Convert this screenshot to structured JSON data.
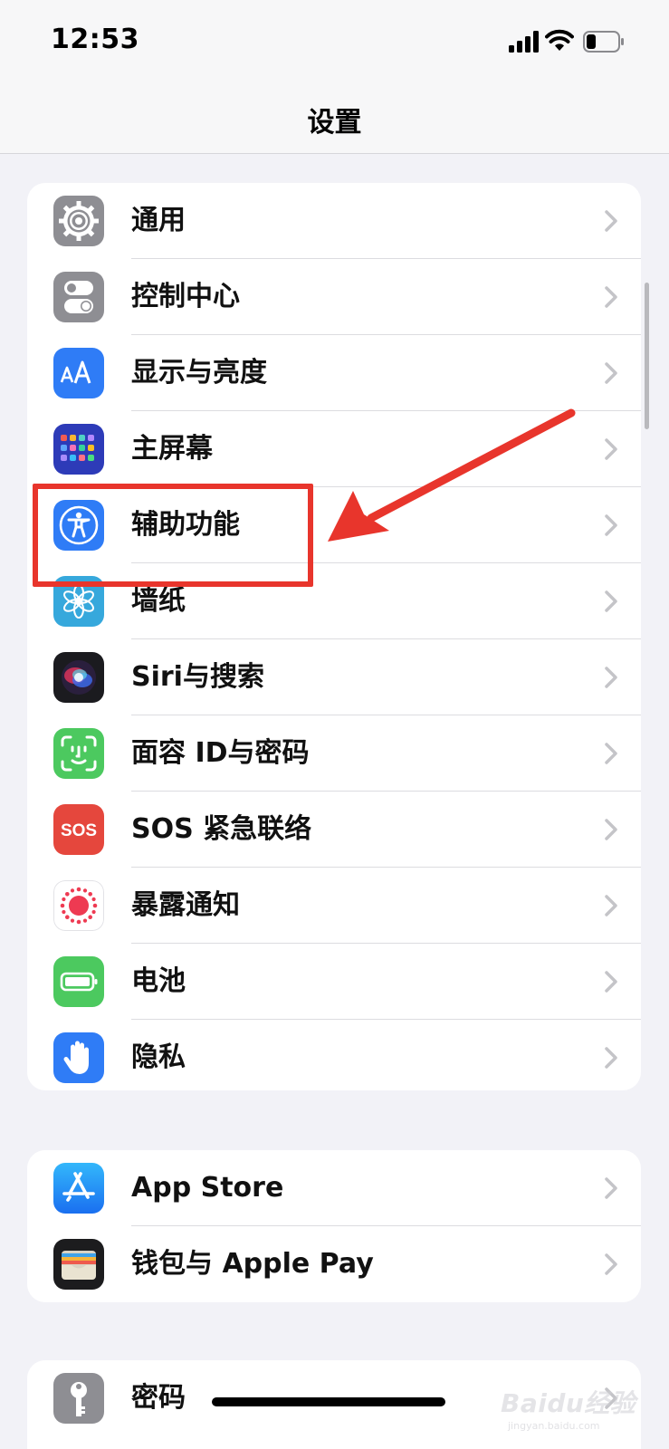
{
  "status_bar": {
    "time": "12:53"
  },
  "nav": {
    "title": "设置"
  },
  "groups": [
    {
      "items": [
        {
          "label": "通用",
          "icon": "gear-icon",
          "color": "#8e8e93"
        },
        {
          "label": "控制中心",
          "icon": "control-center-icon",
          "color": "#8e8e93"
        },
        {
          "label": "显示与亮度",
          "icon": "display-brightness-icon",
          "color": "#2f7cf6"
        },
        {
          "label": "主屏幕",
          "icon": "home-screen-icon",
          "color": "#2d3bb8"
        },
        {
          "label": "辅助功能",
          "icon": "accessibility-icon",
          "color": "#2f7cf6"
        },
        {
          "label": "墙纸",
          "icon": "wallpaper-flower-icon",
          "color": "#36a8dc"
        },
        {
          "label": "Siri与搜索",
          "icon": "siri-icon",
          "color": "#1b1b1f"
        },
        {
          "label": "面容 ID与密码",
          "icon": "face-id-icon",
          "color": "#4cc95f"
        },
        {
          "label": "SOS 紧急联络",
          "icon": "sos-icon",
          "color": "#e5473d"
        },
        {
          "label": "暴露通知",
          "icon": "exposure-notification-icon",
          "color": "#ffffff"
        },
        {
          "label": "电池",
          "icon": "battery-icon",
          "color": "#4cc95f"
        },
        {
          "label": "隐私",
          "icon": "privacy-hand-icon",
          "color": "#2f7cf6"
        }
      ]
    },
    {
      "items": [
        {
          "label": "App Store",
          "icon": "app-store-icon",
          "color": "#1f8cf5"
        },
        {
          "label": "钱包与 Apple Pay",
          "icon": "wallet-icon",
          "color": "#1c1c1e"
        }
      ]
    },
    {
      "items": [
        {
          "label": "密码",
          "icon": "key-icon",
          "color": "#8e8e93"
        }
      ]
    }
  ],
  "watermark": {
    "text": "Baidu经验",
    "sub": "jingyan.baidu.com"
  },
  "annotation_color": "#e8352c"
}
